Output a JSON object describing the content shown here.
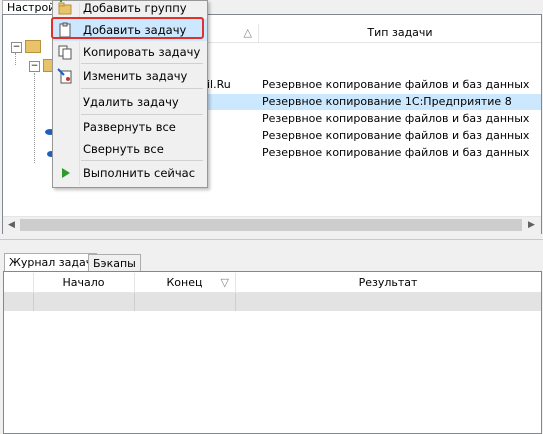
{
  "top_tabs": {
    "settings": "Настрой"
  },
  "context_menu": {
    "items": [
      {
        "label": "Добавить группу",
        "icon": "folder-add-icon"
      },
      {
        "label": "Добавить задачу",
        "icon": "clipboard-icon",
        "highlighted": true
      },
      {
        "label": "Копировать задачу",
        "icon": "copy-icon"
      },
      {
        "label": "Изменить задачу",
        "icon": "edit-task-icon"
      },
      {
        "label": "Удалить задачу",
        "icon": ""
      },
      {
        "label": "Развернуть все",
        "icon": ""
      },
      {
        "label": "Свернуть все",
        "icon": ""
      },
      {
        "label": "Выполнить сейчас",
        "icon": "play-icon"
      }
    ],
    "highlight_color": "#e0312a"
  },
  "task_grid": {
    "columns": {
      "name_sort": "△",
      "type": "Тип задачи"
    },
    "rows": [
      {
        "name": "il.Ru",
        "type": "Резервное копирование файлов и баз данных",
        "selected": false
      },
      {
        "name": "",
        "type": "Резервное копирование 1С:Предприятие 8",
        "selected": true
      },
      {
        "name": "",
        "type": "Резервное копирование файлов и баз данных",
        "selected": false
      },
      {
        "name": "",
        "type": "Резервное копирование файлов и баз данных",
        "selected": false
      },
      {
        "name": "",
        "type": "Резервное копирование файлов и баз данных",
        "selected": false
      }
    ]
  },
  "bottom_tabs": {
    "journal": "Журнал задач",
    "backups": "Бэкапы"
  },
  "journal_grid": {
    "columns": {
      "start": "Начало",
      "end": "Конец",
      "end_sort": "▽",
      "result": "Результат"
    }
  },
  "colors": {
    "selection": "#cce8ff",
    "background": "#f0f0f0"
  }
}
